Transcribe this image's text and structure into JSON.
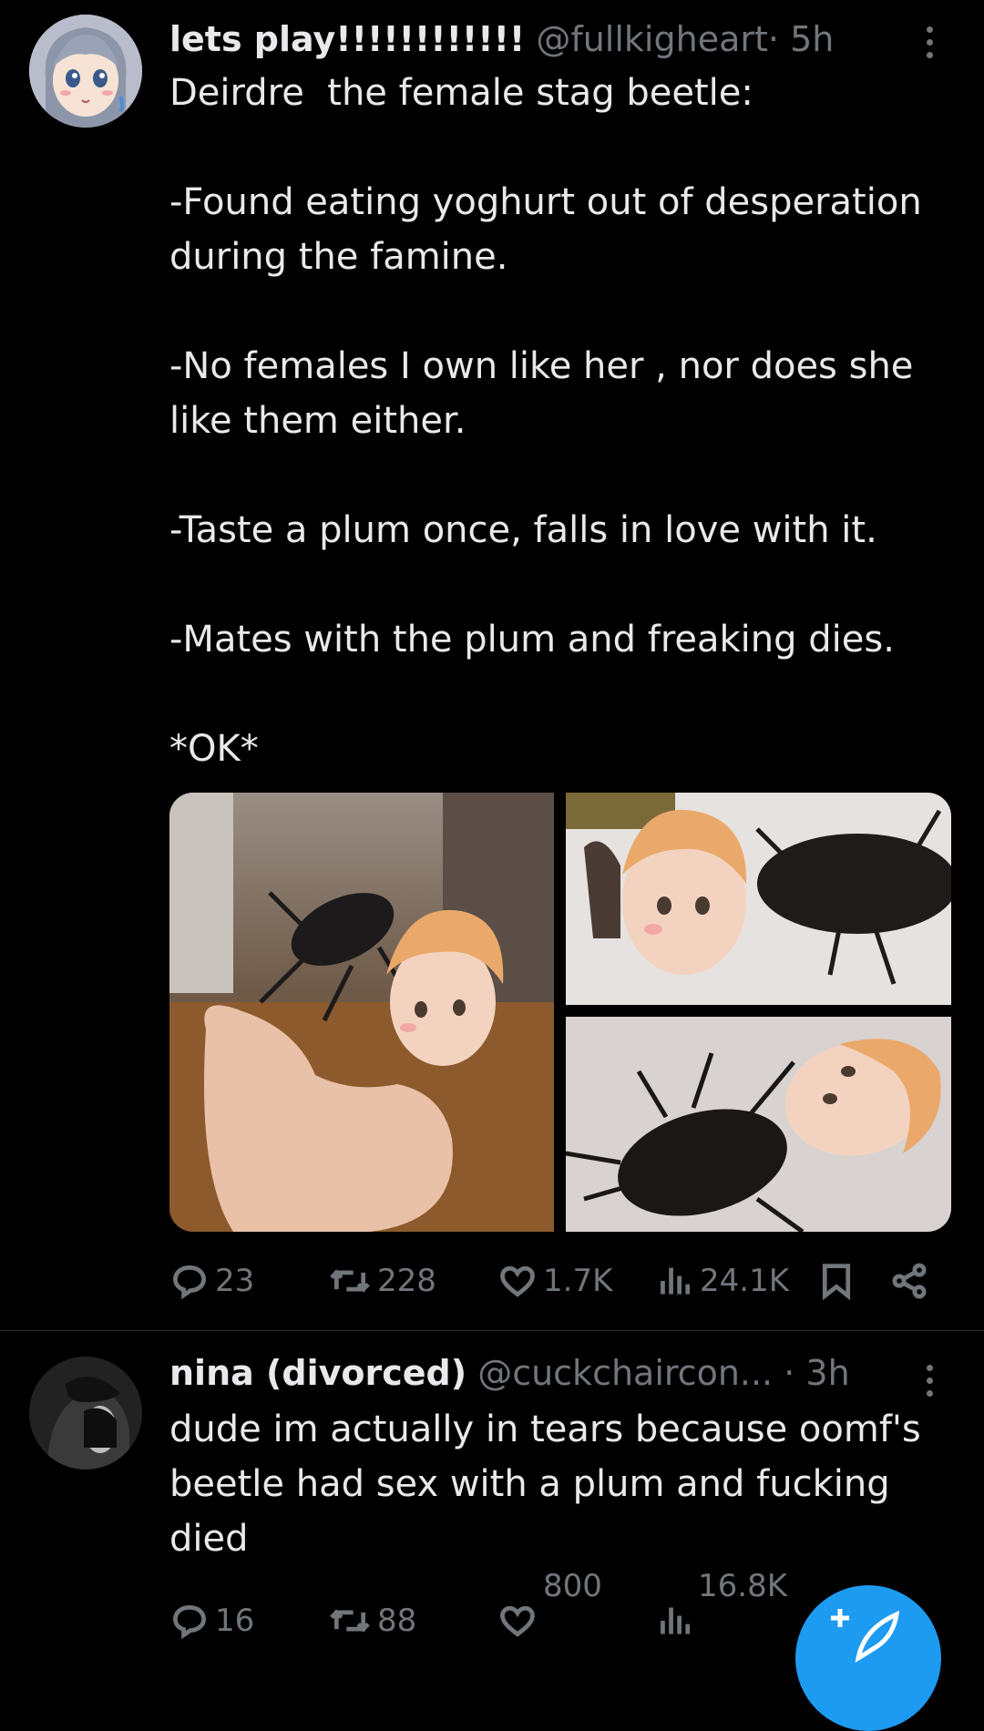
{
  "tweet1": {
    "display_name": "lets play!!!!!!!!!!!!",
    "handle": "@fullkigheart",
    "separator": "·",
    "time": "5h",
    "text": "Deirdre  the female stag beetle:\n\n-Found eating yoghurt out of desperation during the famine.\n\n-No females I own like her , nor does she like them either.\n\n-Taste a plum once, falls in love with it.\n\n-Mates with the plum and freaking dies.\n\n*OK*",
    "media_count": 3,
    "replies": "23",
    "retweets": "228",
    "likes": "1.7K",
    "views": "24.1K"
  },
  "tweet2": {
    "display_name": "nina (divorced)",
    "handle": "@cuckchaircon...",
    "separator": "·",
    "time": "3h",
    "text": "dude im actually in tears because oomf's beetle had sex with a plum and fucking died",
    "replies": "16",
    "retweets": "88",
    "likes": "800",
    "views": "16.8K"
  },
  "icons": {
    "reply": "reply-icon",
    "retweet": "retweet-icon",
    "like": "heart-icon",
    "views": "views-icon",
    "bookmark": "bookmark-icon",
    "share": "share-icon",
    "more": "more-icon",
    "compose": "compose-icon"
  },
  "colors": {
    "background": "#000000",
    "text": "#e7e9ea",
    "secondary": "#71767b",
    "accent": "#1d9bf0",
    "divider": "#2f3336"
  }
}
